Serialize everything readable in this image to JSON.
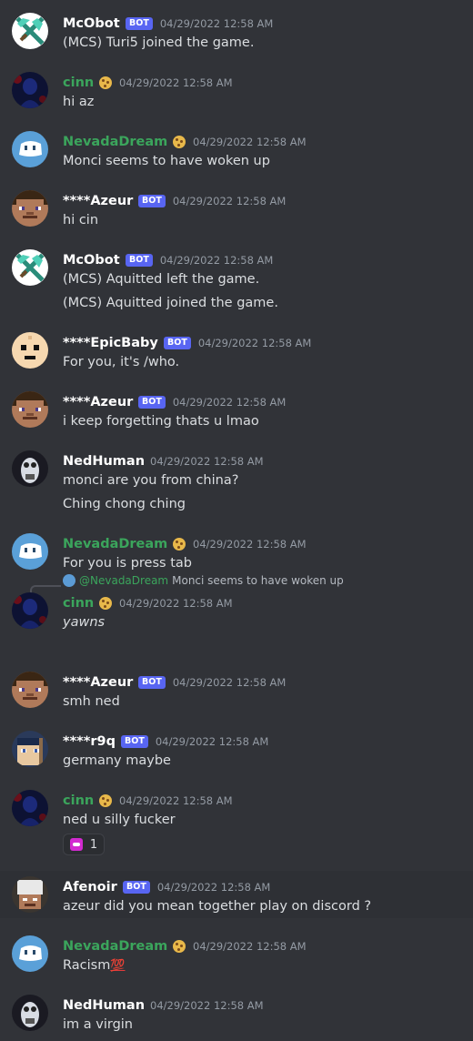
{
  "bot_label": "BOT",
  "messages": [
    {
      "author": "McObot",
      "color": "#ffffff",
      "bot": true,
      "badge": false,
      "time": "04/29/2022 12:58 AM",
      "lines": [
        "(MCS) Turi5 joined the game."
      ],
      "avatar": "pickaxe-avatar"
    },
    {
      "author": "cinn",
      "color": "#3ba55c",
      "bot": false,
      "badge": true,
      "time": "04/29/2022 12:58 AM",
      "lines": [
        "hi az"
      ],
      "avatar": "dark-avatar"
    },
    {
      "author": "NevadaDream",
      "color": "#3ba55c",
      "bot": false,
      "badge": true,
      "time": "04/29/2022 12:58 AM",
      "lines": [
        "Monci seems to have woken up"
      ],
      "avatar": "ghost-avatar"
    },
    {
      "author": "****Azeur",
      "color": "#ffffff",
      "bot": true,
      "badge": false,
      "time": "04/29/2022 12:58 AM",
      "lines": [
        "hi cin"
      ],
      "avatar": "steve-avatar"
    },
    {
      "author": "McObot",
      "color": "#ffffff",
      "bot": true,
      "badge": false,
      "time": "04/29/2022 12:58 AM",
      "lines": [
        "(MCS) Aquitted left the game.",
        "(MCS) Aquitted joined the game."
      ],
      "avatar": "pickaxe-avatar"
    },
    {
      "author": "****EpicBaby",
      "color": "#ffffff",
      "bot": true,
      "badge": false,
      "time": "04/29/2022 12:58 AM",
      "lines": [
        "For you, it's /who."
      ],
      "avatar": "baby-avatar"
    },
    {
      "author": "****Azeur",
      "color": "#ffffff",
      "bot": true,
      "badge": false,
      "time": "04/29/2022 12:58 AM",
      "lines": [
        "i keep forgetting thats u lmao"
      ],
      "avatar": "steve-avatar"
    },
    {
      "author": "NedHuman",
      "color": "#ffffff",
      "bot": false,
      "badge": false,
      "time": "04/29/2022 12:58 AM",
      "lines": [
        "monci are you from china?",
        "Ching chong ching"
      ],
      "avatar": "robot-avatar"
    },
    {
      "author": "NevadaDream",
      "color": "#3ba55c",
      "bot": false,
      "badge": true,
      "time": "04/29/2022 12:58 AM",
      "lines": [
        "For you is press tab"
      ],
      "avatar": "ghost-avatar"
    },
    {
      "author": "cinn",
      "color": "#3ba55c",
      "bot": false,
      "badge": true,
      "time": "04/29/2022 12:58 AM",
      "lines": [
        "yawns"
      ],
      "italic": true,
      "avatar": "dark-avatar",
      "reply": {
        "mention": "@NevadaDream",
        "text": "Monci seems to have woken up"
      }
    },
    {
      "author": "****Azeur",
      "color": "#ffffff",
      "bot": true,
      "badge": false,
      "time": "04/29/2022 12:58 AM",
      "lines": [
        "smh ned"
      ],
      "avatar": "steve-avatar"
    },
    {
      "author": "****r9q",
      "color": "#ffffff",
      "bot": true,
      "badge": false,
      "time": "04/29/2022 12:58 AM",
      "lines": [
        "germany maybe"
      ],
      "avatar": "skin-avatar"
    },
    {
      "author": "cinn",
      "color": "#3ba55c",
      "bot": false,
      "badge": true,
      "time": "04/29/2022 12:58 AM",
      "lines": [
        "ned u silly fucker"
      ],
      "avatar": "dark-avatar",
      "reaction": {
        "count": "1"
      }
    },
    {
      "author": "Afenoir",
      "color": "#ffffff",
      "bot": true,
      "badge": false,
      "time": "04/29/2022 12:58 AM",
      "lines": [
        "azeur did you mean together play on discord ?"
      ],
      "avatar": "helmet-avatar",
      "highlight": true
    },
    {
      "author": "NevadaDream",
      "color": "#3ba55c",
      "bot": false,
      "badge": true,
      "time": "04/29/2022 12:58 AM",
      "lines": [
        "Racism"
      ],
      "suffix": "💯",
      "avatar": "ghost-avatar"
    },
    {
      "author": "NedHuman",
      "color": "#ffffff",
      "bot": false,
      "badge": false,
      "time": "04/29/2022 12:58 AM",
      "lines": [
        "im a virgin"
      ],
      "avatar": "robot-avatar"
    }
  ]
}
